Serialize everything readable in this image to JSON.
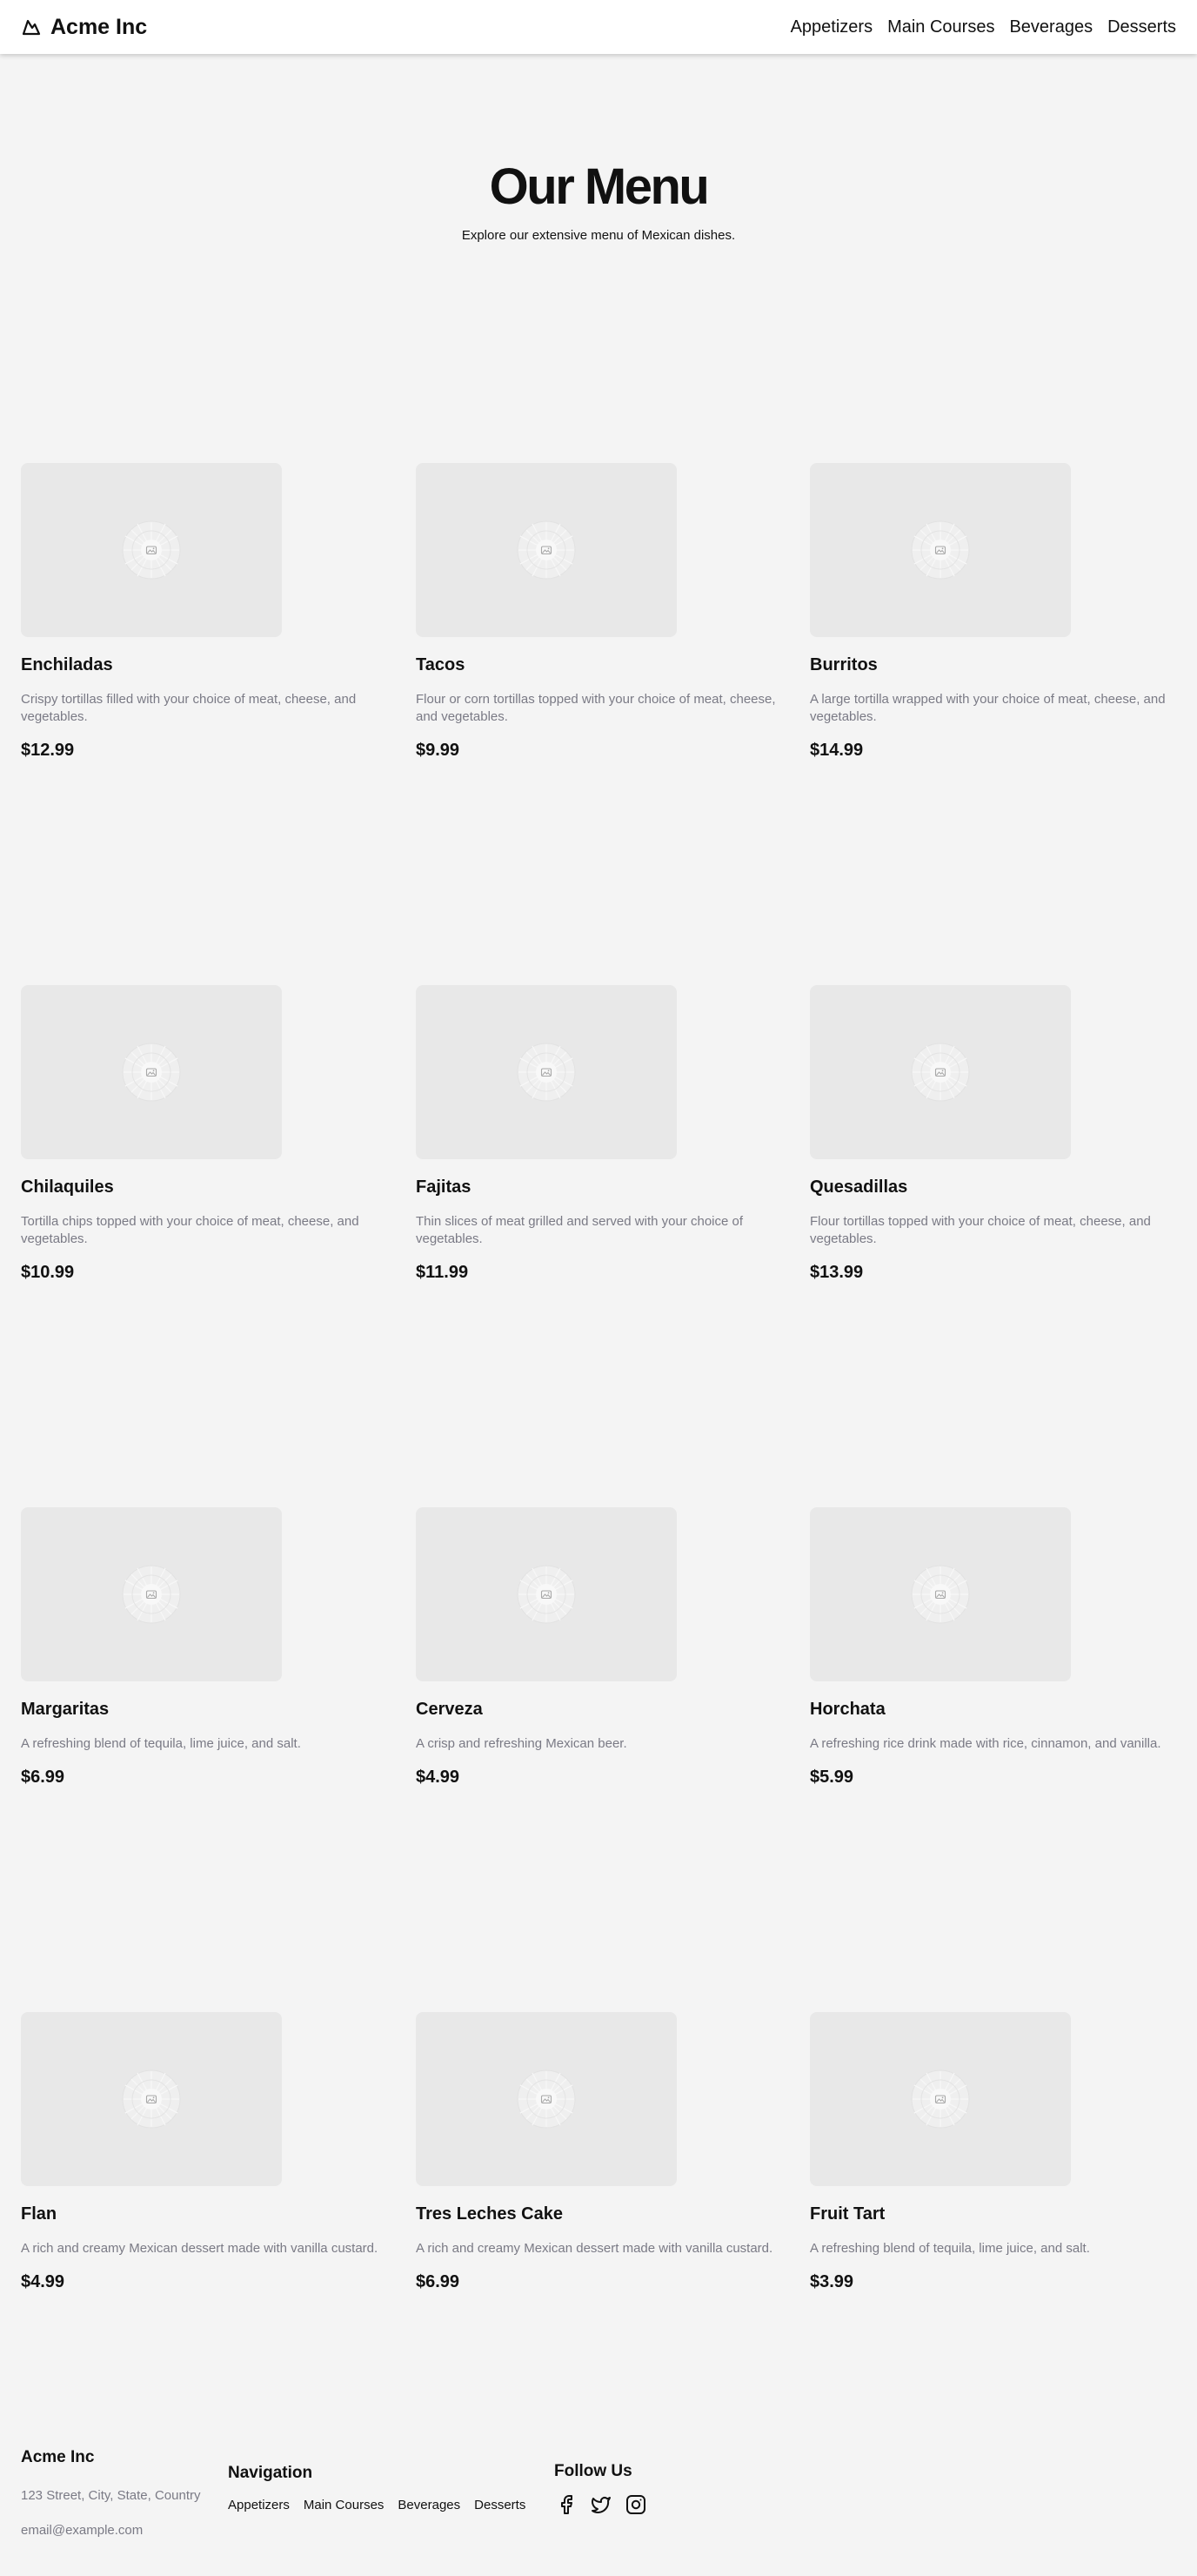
{
  "header": {
    "brand": "Acme Inc",
    "nav": [
      "Appetizers",
      "Main Courses",
      "Beverages",
      "Desserts"
    ]
  },
  "hero": {
    "title": "Our Menu",
    "subtitle": "Explore our extensive menu of Mexican dishes."
  },
  "menu": {
    "items": [
      {
        "name": "Enchiladas",
        "description": "Crispy tortillas filled with your choice of meat, cheese, and vegetables.",
        "price": "$12.99"
      },
      {
        "name": "Tacos",
        "description": "Flour or corn tortillas topped with your choice of meat, cheese, and vegetables.",
        "price": "$9.99"
      },
      {
        "name": "Burritos",
        "description": "A large tortilla wrapped with your choice of meat, cheese, and vegetables.",
        "price": "$14.99"
      },
      {
        "name": "Chilaquiles",
        "description": "Tortilla chips topped with your choice of meat, cheese, and vegetables.",
        "price": "$10.99"
      },
      {
        "name": "Fajitas",
        "description": "Thin slices of meat grilled and served with your choice of vegetables.",
        "price": "$11.99"
      },
      {
        "name": "Quesadillas",
        "description": "Flour tortillas topped with your choice of meat, cheese, and vegetables.",
        "price": "$13.99"
      },
      {
        "name": "Margaritas",
        "description": "A refreshing blend of tequila, lime juice, and salt.",
        "price": "$6.99"
      },
      {
        "name": "Cerveza",
        "description": "A crisp and refreshing Mexican beer.",
        "price": "$4.99"
      },
      {
        "name": "Horchata",
        "description": "A refreshing rice drink made with rice, cinnamon, and vanilla.",
        "price": "$5.99"
      },
      {
        "name": "Flan",
        "description": "A rich and creamy Mexican dessert made with vanilla custard.",
        "price": "$4.99"
      },
      {
        "name": "Tres Leches Cake",
        "description": "A rich and creamy Mexican dessert made with vanilla custard.",
        "price": "$6.99"
      },
      {
        "name": "Fruit Tart",
        "description": "A refreshing blend of tequila, lime juice, and salt.",
        "price": "$3.99"
      }
    ]
  },
  "footer": {
    "brand": "Acme Inc",
    "address": "123 Street, City, State, Country",
    "email": "email@example.com",
    "nav_title": "Navigation",
    "nav": [
      "Appetizers",
      "Main Courses",
      "Beverages",
      "Desserts"
    ],
    "social_title": "Follow Us",
    "social_icons": [
      "facebook-icon",
      "twitter-icon",
      "instagram-icon"
    ]
  },
  "colors": {
    "background": "#f4f4f4",
    "header": "#ffffff",
    "placeholder": "#e8e8e8",
    "muted_text": "#7a7a85",
    "text": "#111111"
  }
}
